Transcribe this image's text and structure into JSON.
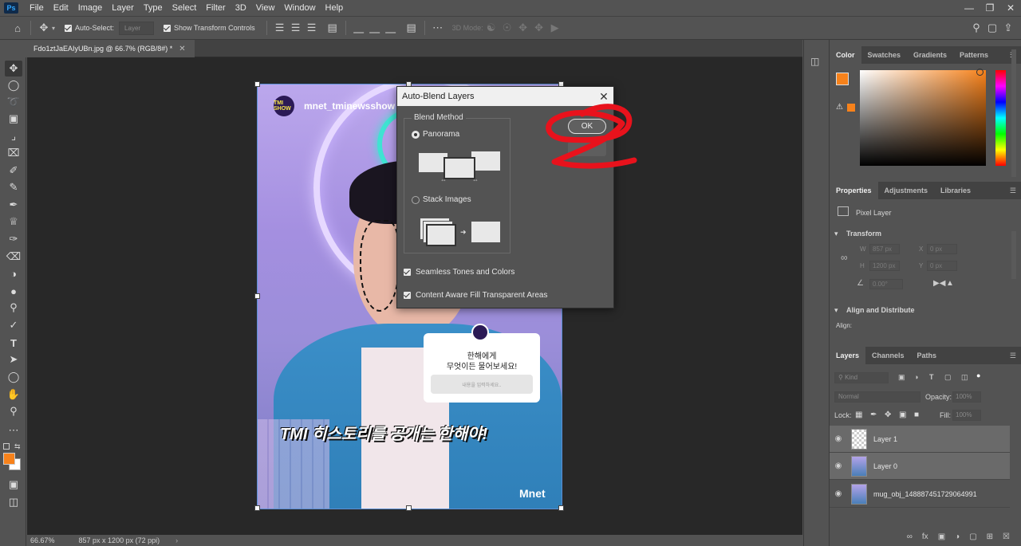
{
  "app": {
    "logo": "Ps",
    "menu": [
      "File",
      "Edit",
      "Image",
      "Layer",
      "Type",
      "Select",
      "Filter",
      "3D",
      "View",
      "Window",
      "Help"
    ]
  },
  "options": {
    "auto_select_label": "Auto-Select:",
    "auto_select_target": "Layer",
    "show_transform_label": "Show Transform Controls",
    "mode_3d_label": "3D Mode:"
  },
  "document": {
    "tab_title": "Fdo1ztJaEAIyUBn.jpg @ 66.7% (RGB/8#) *",
    "zoom": "66.67%",
    "size_info": "857 px x 1200 px (72 ppi)"
  },
  "image_content": {
    "account_name": "mnet_tminewsshow",
    "logo_text": "TMI SHOW",
    "card_line1": "한해에게",
    "card_line2": "무엇이든 물어보세요!",
    "card_input_placeholder": "내용을 입력하세요..",
    "caption": "TMI 히스토리를 공개는 한해야!",
    "brand": "Mnet"
  },
  "dialog": {
    "title": "Auto-Blend Layers",
    "group_label": "Blend Method",
    "option_panorama": "Panorama",
    "option_stack": "Stack Images",
    "seamless_label": "Seamless Tones and Colors",
    "content_aware_label": "Content Aware Fill Transparent Areas",
    "ok_label": "OK"
  },
  "color_panel": {
    "tabs": [
      "Color",
      "Swatches",
      "Gradients",
      "Patterns"
    ],
    "foreground": "#f7821b"
  },
  "properties_panel": {
    "tabs": [
      "Properties",
      "Adjustments",
      "Libraries"
    ],
    "layer_type": "Pixel Layer",
    "transform_label": "Transform",
    "w_label": "W",
    "w_value": "857 px",
    "h_label": "H",
    "h_value": "1200 px",
    "x_label": "X",
    "x_value": "0 px",
    "y_label": "Y",
    "y_value": "0 px",
    "angle_value": "0.00°",
    "align_label": "Align and Distribute",
    "align_sub": "Align:"
  },
  "layers_panel": {
    "tabs": [
      "Layers",
      "Channels",
      "Paths"
    ],
    "filter_label": "Kind",
    "blend_mode": "Normal",
    "opacity_label": "Opacity:",
    "opacity_value": "100%",
    "lock_label": "Lock:",
    "fill_label": "Fill:",
    "fill_value": "100%",
    "layers": [
      {
        "name": "Layer 1"
      },
      {
        "name": "Layer 0"
      },
      {
        "name": "mug_obj_1488874517290649​91"
      }
    ]
  },
  "colors": {
    "accent_red": "#e8121c",
    "foreground_orange": "#f7821b"
  }
}
